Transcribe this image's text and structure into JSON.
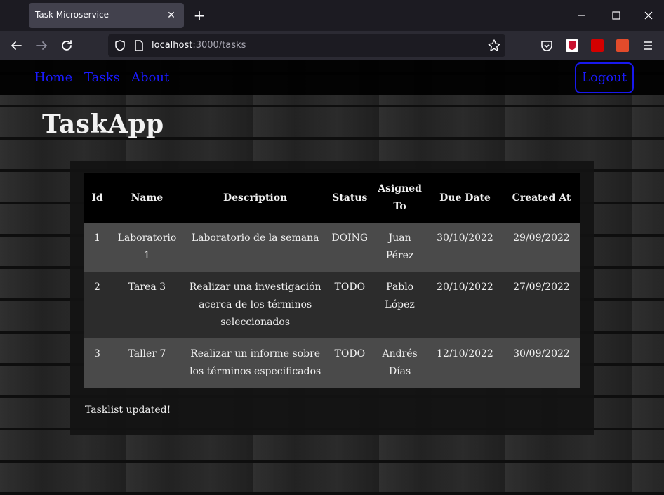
{
  "browser": {
    "tab_title": "Task Microservice",
    "tab_close": "✕",
    "new_tab": "+",
    "url_host": "localhost",
    "url_path": ":3000/tasks"
  },
  "site": {
    "nav": {
      "home": "Home",
      "tasks": "Tasks",
      "about": "About",
      "logout": "Logout"
    },
    "brand": "TaskApp"
  },
  "table": {
    "headers": [
      "Id",
      "Name",
      "Description",
      "Status",
      "Asigned To",
      "Due Date",
      "Created At"
    ],
    "rows": [
      {
        "id": "1",
        "name": "Laboratorio 1",
        "description": "Laboratorio de la semana",
        "status": "DOING",
        "assigned": "Juan Pérez",
        "due": "30/10/2022",
        "created": "29/09/2022"
      },
      {
        "id": "2",
        "name": "Tarea 3",
        "description": "Realizar una investigación acerca de los términos seleccionados",
        "status": "TODO",
        "assigned": "Pablo López",
        "due": "20/10/2022",
        "created": "27/09/2022"
      },
      {
        "id": "3",
        "name": "Taller 7",
        "description": "Realizar un informe sobre los términos especificados",
        "status": "TODO",
        "assigned": "Andrés Días",
        "due": "12/10/2022",
        "created": "30/09/2022"
      }
    ]
  },
  "status_message": "Tasklist updated!"
}
